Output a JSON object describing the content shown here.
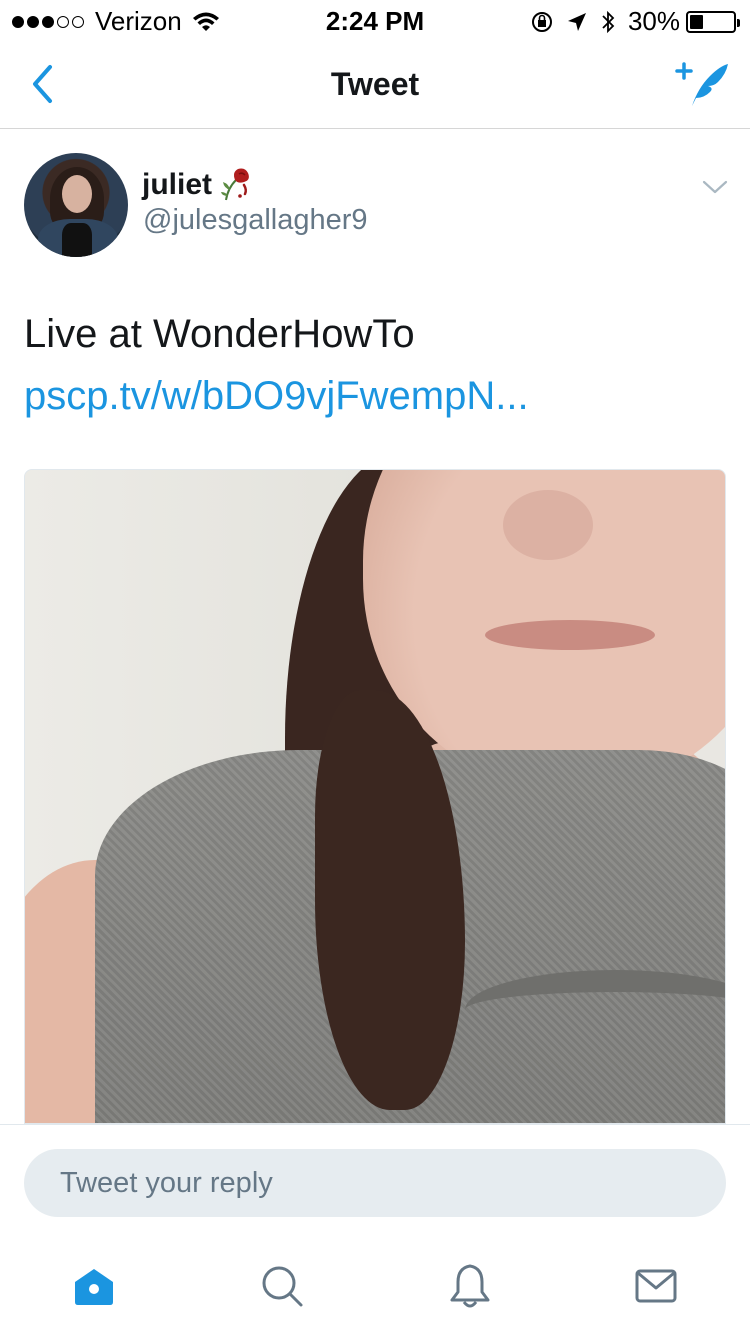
{
  "status_bar": {
    "signal_bars_filled": 3,
    "signal_bars_total": 5,
    "carrier": "Verizon",
    "time": "2:24 PM",
    "battery_percent": "30%",
    "battery_level": 0.3,
    "icons": [
      "wifi-icon",
      "orientation-lock-icon",
      "location-arrow-icon",
      "bluetooth-icon",
      "battery-icon"
    ]
  },
  "nav": {
    "title": "Tweet",
    "back_icon": "chevron-left-icon",
    "compose_icon": "compose-tweet-icon",
    "accent_color": "#1b95e0"
  },
  "tweet": {
    "display_name": "juliet",
    "name_emoji": "wilted-rose-icon",
    "handle": "@julesgallagher9",
    "text": "Live at WonderHowTo ",
    "link": "pscp.tv/w/bDO9vjFwempN...",
    "menu_icon": "chevron-down-icon"
  },
  "reply": {
    "placeholder": "Tweet your reply"
  },
  "tab_bar": {
    "items": [
      "home-icon",
      "search-icon",
      "notifications-icon",
      "messages-icon"
    ],
    "active": "home-icon"
  }
}
